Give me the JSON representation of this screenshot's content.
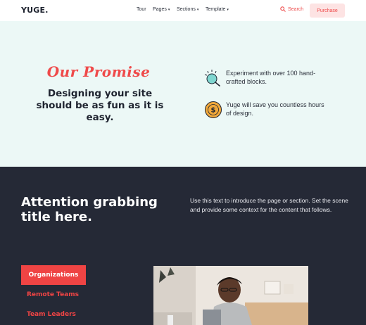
{
  "nav": {
    "logo": "YUGE.",
    "items": [
      {
        "label": "Tour",
        "has_caret": false
      },
      {
        "label": "Pages",
        "has_caret": true
      },
      {
        "label": "Sections",
        "has_caret": true
      },
      {
        "label": "Template",
        "has_caret": true
      }
    ],
    "search_label": "Search",
    "search_icon": "search-icon",
    "purchase_label": "Purchase"
  },
  "hero": {
    "kicker": "Our Promise",
    "title": "Designing your site should be as fun as it is easy.",
    "features": [
      {
        "icon": "magnifier-sparkle-icon",
        "text": "Experiment with over 100 hand-crafted blocks."
      },
      {
        "icon": "coin-icon",
        "text": "Yuge will save you countless hours of design."
      }
    ]
  },
  "section": {
    "title": "Attention grabbing title here.",
    "text": "Use this text to introduce the page or section. Set the scene and provide some context for the content that follows.",
    "tabs": [
      "Organizations",
      "Remote Teams",
      "Team Leaders"
    ],
    "active_tab": 0
  },
  "colors": {
    "accent": "#ef4444",
    "hero_bg": "#ecf8f6",
    "dark_bg": "#252936",
    "text_dark": "#1f2430"
  }
}
